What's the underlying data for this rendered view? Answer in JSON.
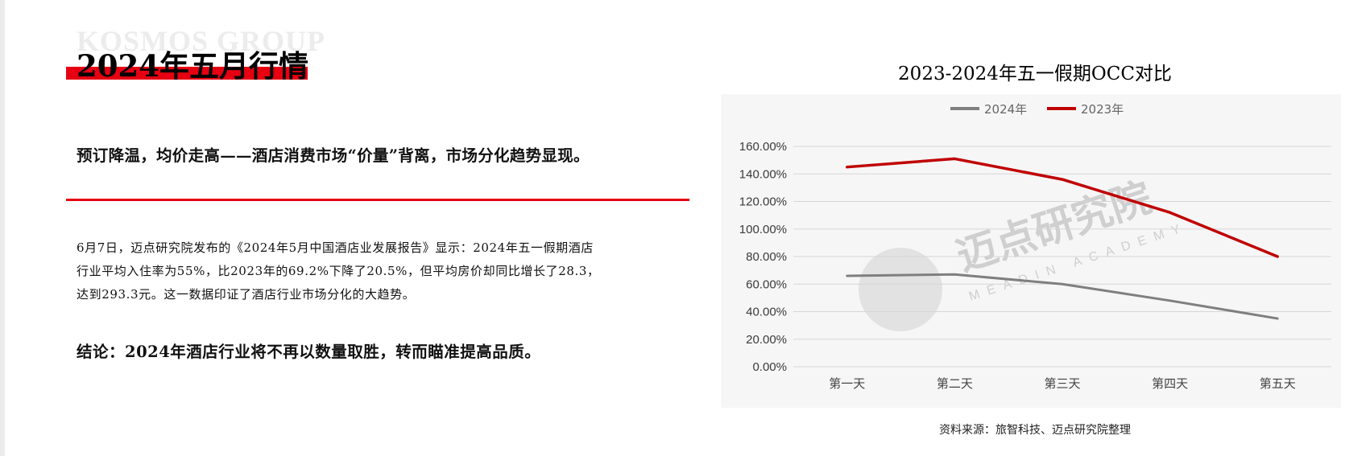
{
  "header": {
    "brand_watermark": "KOSMOS GROUP",
    "title": "2024年五月行情"
  },
  "headline": "预订降温，均价走高——酒店消费市场“价量”背离，市场分化趋势显现。",
  "body": [
    "6月7日，迈点研究院发布的《2024年5月中国酒店业发展报告》显示：2024年五一假期酒店",
    "行业平均入住率为55%，比2023年的69.2%下降了20.5%，但平均房价却同比增长了28.3，",
    "达到293.3元。这一数据印证了酒店行业市场分化的大趋势。"
  ],
  "conclusion": "结论：2024年酒店行业将不再以数量取胜，转而瞄准提高品质。",
  "chart_watermark": {
    "text": "迈点研究院",
    "sub": "MEADIN ACADEMY"
  },
  "source": "资料来源：旅智科技、迈点研究院整理",
  "chart_data": {
    "type": "line",
    "title": "2023-2024年五一假期OCC对比",
    "categories": [
      "第一天",
      "第二天",
      "第三天",
      "第四天",
      "第五天"
    ],
    "series": [
      {
        "name": "2024年",
        "values": [
          0.66,
          0.67,
          0.6,
          0.48,
          0.35
        ],
        "color": "#7f7f7f"
      },
      {
        "name": "2023年",
        "values": [
          1.45,
          1.51,
          1.36,
          1.12,
          0.8
        ],
        "color": "#c00000"
      }
    ],
    "yticks": [
      "0.00%",
      "20.00%",
      "40.00%",
      "60.00%",
      "80.00%",
      "100.00%",
      "120.00%",
      "140.00%",
      "160.00%"
    ],
    "ylim": [
      0,
      1.6
    ],
    "grid": true,
    "legend": "top"
  }
}
